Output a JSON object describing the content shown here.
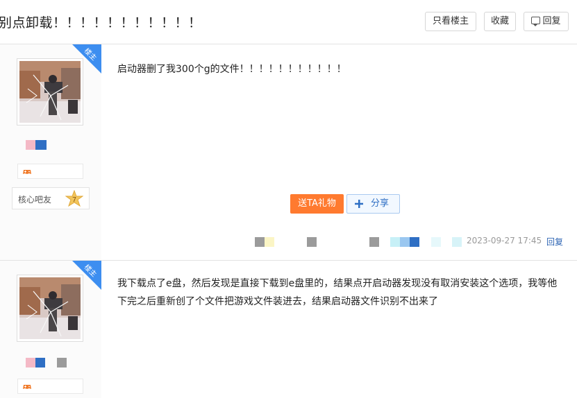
{
  "header": {
    "title": "别点卸载！！！！！！！！！！！",
    "only_op_label": "只看楼主",
    "favorite_label": "收藏",
    "reply_label": "回复"
  },
  "posts": [
    {
      "badge": "楼主",
      "fan_club": "核心吧友",
      "level": "7",
      "content": "启动器删了我300个g的文件！！！！！！！！！！！",
      "gift_label": "送TA礼物",
      "share_label": "分享",
      "date": "2023-09-27 17:45",
      "reply_label": "回复"
    },
    {
      "badge": "楼主",
      "content": "我下载点了e盘，然后发现是直接下载到e盘里的，结果点开启动器发现没有取消安装这个选项，我等他下完之后重新创了个文件把游戏文件装进去，结果启动器文件识别不出来了"
    }
  ],
  "colors": {
    "ribbon": "#3d8ef0",
    "gift": "#ff7a2f",
    "link": "#2d64b3"
  }
}
